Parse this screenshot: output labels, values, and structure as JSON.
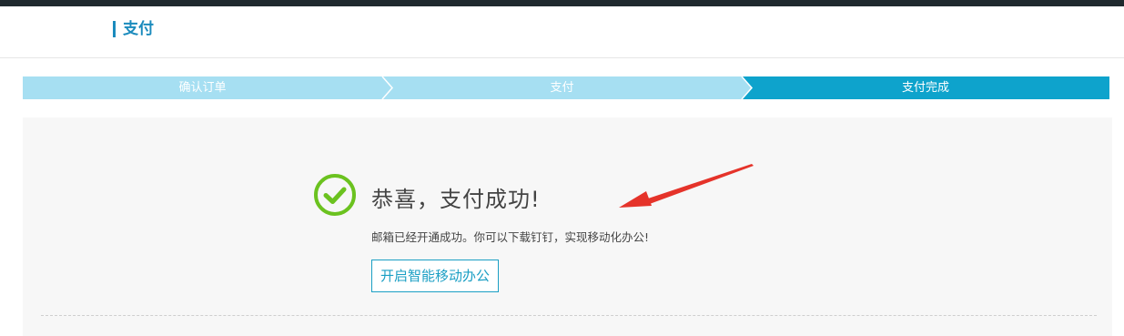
{
  "header": {
    "title": "支付"
  },
  "steps": [
    {
      "label": "确认订单",
      "state": "done"
    },
    {
      "label": "支付",
      "state": "done"
    },
    {
      "label": "支付完成",
      "state": "current"
    }
  ],
  "result": {
    "title": "恭喜，支付成功!",
    "description": "邮箱已经开通成功。你可以下载钉钉，实现移动化办公!",
    "action_label": "开启智能移动办公"
  },
  "colors": {
    "accent": "#0ea3cc",
    "step_light": "#a6dff2",
    "success": "#6bc21f",
    "annotation_arrow": "#e5332a"
  },
  "icons": {
    "status": "check-circle-icon",
    "annotation": "red-arrow-annotation"
  }
}
